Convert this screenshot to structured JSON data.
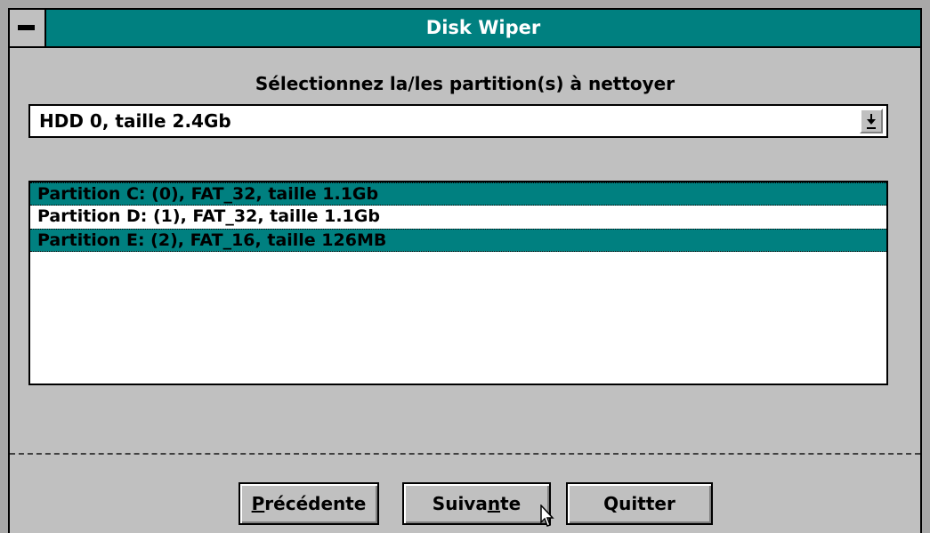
{
  "window": {
    "title": "Disk Wiper",
    "prompt": "Sélectionnez la/les partition(s) à nettoyer"
  },
  "disk_select": {
    "selected": "HDD 0, taille 2.4Gb"
  },
  "partitions": [
    {
      "label": "Partition C: (0), FAT_32, taille 1.1Gb",
      "selected": true
    },
    {
      "label": "Partition D: (1), FAT_32, taille 1.1Gb",
      "selected": false
    },
    {
      "label": "Partition E: (2), FAT_16, taille 126MB",
      "selected": true
    }
  ],
  "buttons": {
    "previous_mnemonic": "P",
    "previous_rest": "récédente",
    "next_pre": "Suiva",
    "next_mnemonic": "n",
    "next_post": "te",
    "quit": "Quitter"
  },
  "colors": {
    "titlebar": "#008080",
    "selection": "#008080",
    "face": "#c0c0c0"
  }
}
